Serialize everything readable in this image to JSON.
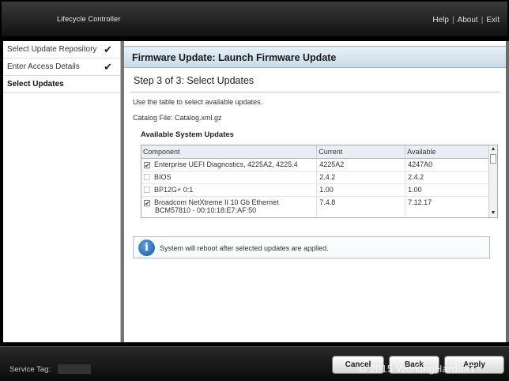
{
  "header": {
    "app_title": "Lifecycle Controller",
    "links": {
      "help": "Help",
      "about": "About",
      "exit": "Exit"
    },
    "separator": "|"
  },
  "sidebar": {
    "items": [
      {
        "label": "Select Update Repository",
        "check": "✔"
      },
      {
        "label": "Enter Access Details",
        "check": "✔"
      },
      {
        "label": "Select Updates",
        "check": ""
      }
    ]
  },
  "main": {
    "page_title": "Firmware Update: Launch Firmware Update",
    "step_title": "Step 3 of 3: Select Updates",
    "instruction": "Use the table to select available updates.",
    "catalog_file": "Catalog File: Catalog.xml.gz",
    "section_title": "Available System Updates",
    "table": {
      "columns": [
        "Component",
        "Current",
        "Available"
      ],
      "rows": [
        {
          "checked": true,
          "enabled": true,
          "component": "Enterprise UEFI Diagnostics, 4225A2, 4225.4",
          "component2": "",
          "current": "4225A2",
          "available": "4247A0"
        },
        {
          "checked": false,
          "enabled": false,
          "component": "BIOS",
          "component2": "",
          "current": "2.4.2",
          "available": "2.4.2"
        },
        {
          "checked": false,
          "enabled": false,
          "component": "BP12G+ 0:1",
          "component2": "",
          "current": "1.00",
          "available": "1.00"
        },
        {
          "checked": true,
          "enabled": true,
          "component": "Broadcom NetXtreme II 10 Gb Ethernet",
          "component2": "BCM57810 - 00:10:18:E7:AF:50",
          "current": "7.4.8",
          "available": "7.12.17"
        }
      ]
    },
    "info_message": "System will reboot after selected updates are applied."
  },
  "footer": {
    "service_tag_label": "Service Tag:",
    "buttons": {
      "cancel": "Cancel",
      "back": "Back",
      "apply": "Apply"
    },
    "watermark": "© 2015 WorkingHardInIT"
  }
}
